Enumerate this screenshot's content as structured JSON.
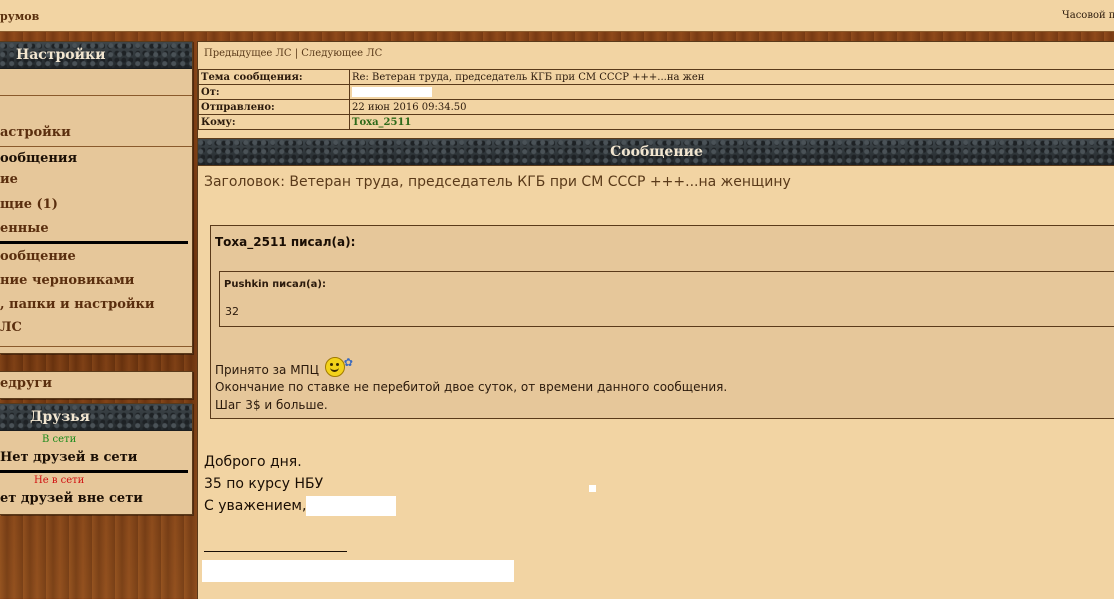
{
  "topbar": {
    "left_text": "румов",
    "right_text": "Часовой по"
  },
  "sidebar": {
    "settings_title": "Настройки",
    "items": [
      {
        "label": "астройки"
      },
      {
        "label": "ообщения"
      },
      {
        "label": "ие"
      },
      {
        "label": "щие (1)"
      },
      {
        "label": "енные"
      },
      {
        "label": "ообщение"
      },
      {
        "label": "ние черновиками"
      },
      {
        "label": ", папки и настройки"
      },
      {
        "label": "ЛС"
      },
      {
        "label": "едруги"
      }
    ],
    "friends_title": "Друзья",
    "online_label": "В сети",
    "online_empty": "Нет друзей в сети",
    "offline_label": "Не в сети",
    "offline_empty": "ет друзей вне сети"
  },
  "main": {
    "nav_prev": "Предыдущее ЛС",
    "nav_sep": "|",
    "nav_next": "Следующее ЛС",
    "meta": {
      "subject_label": "Тема сообщения:",
      "subject_value": "Re: Ветеран труда, председатель КГБ при СМ СССР +++...на жен",
      "from_label": "От:",
      "sent_label": "Отправлено:",
      "sent_value": "22 июн 2016 09:34.50",
      "to_label": "Кому:",
      "to_value": "Тоха_2511"
    },
    "message_header": "Сообщение",
    "subject_line": "Заголовок: Ветеран труда, председатель КГБ при СМ СССР +++...на женщину",
    "quote": {
      "author": "Тоха_2511 писал(а):",
      "inner_author": "Pushkin писал(а):",
      "inner_text": "32",
      "line1": "Принято за МПЦ",
      "line2": "Окончание по ставке не перебитой двое суток, от времени данного сообщения.",
      "line3": "Шаг 3$ и больше."
    },
    "body": {
      "line1": "Доброго дня.",
      "line2": "35 по курсу НБУ",
      "line3": "С уважением,"
    }
  },
  "colors": {
    "parchment": "#f2d4a3",
    "panel": "#e6c79a",
    "link_green": "#2e6a1a",
    "online_green": "#1a8a1a",
    "offline_red": "#d01010"
  }
}
